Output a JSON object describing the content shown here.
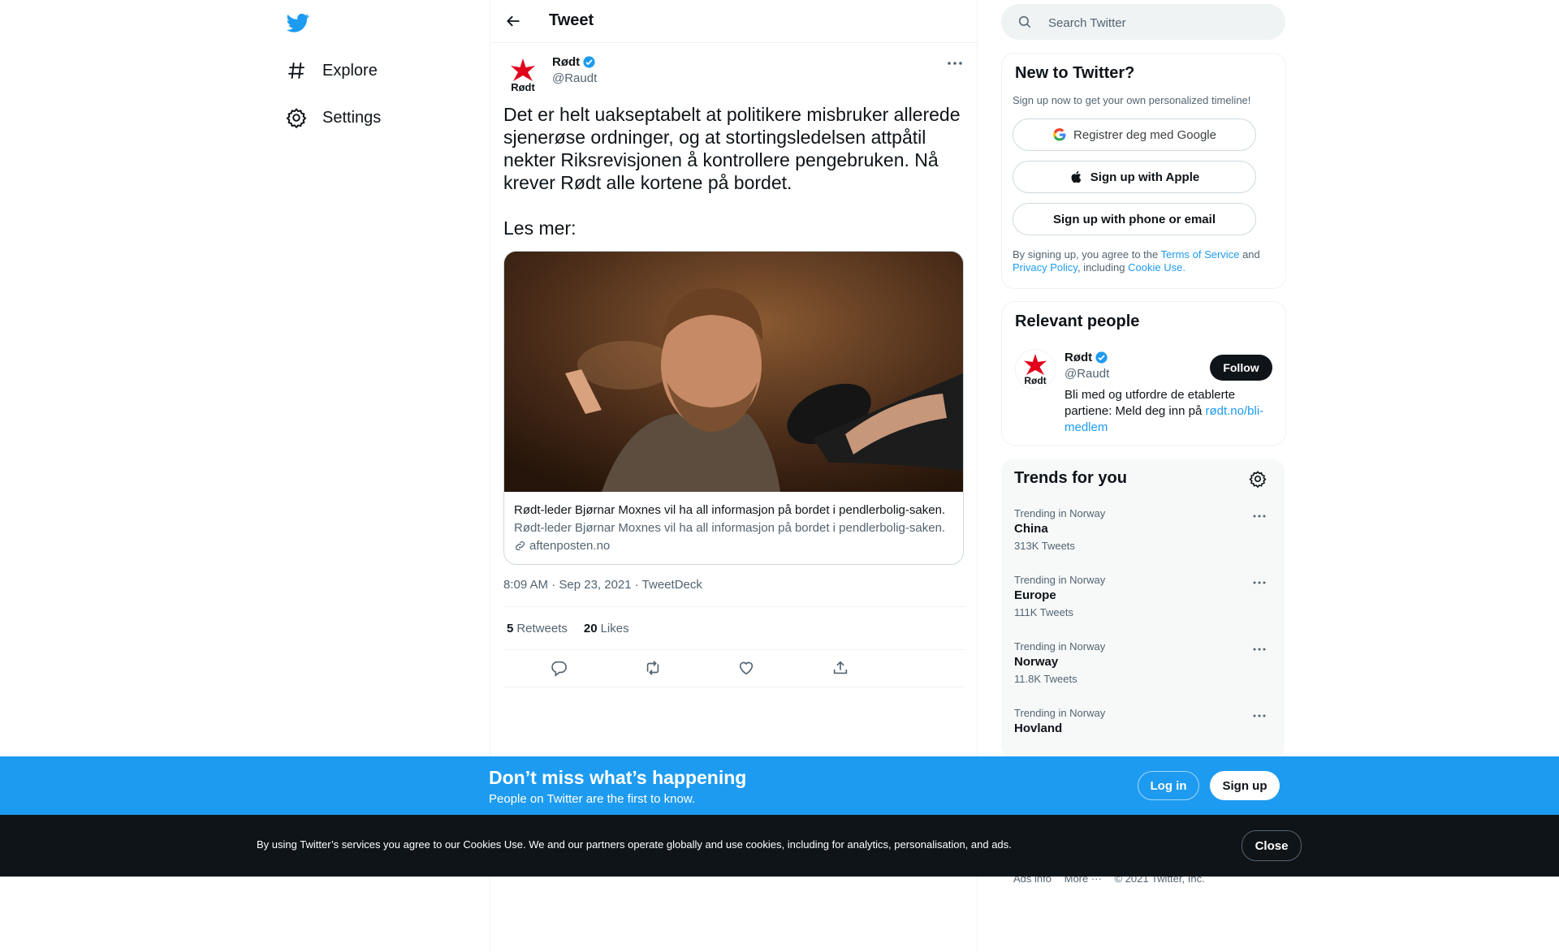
{
  "nav": {
    "items": [
      {
        "label": "Explore",
        "icon": "hashtag-icon"
      },
      {
        "label": "Settings",
        "icon": "gear-icon"
      }
    ]
  },
  "header": {
    "title": "Tweet"
  },
  "tweet": {
    "author_name": "Rødt",
    "author_handle": "@Raudt",
    "text": "Det er helt uakseptabelt at politikere misbruker allerede sjenerøse ordninger, og at stortingsledelsen attpåtil nekter Riksrevisjonen å kontrollere pengebruken. Nå krever Rødt alle kortene på bordet.\n\nLes mer:",
    "card": {
      "title": "Rødt-leder Bjørnar Moxnes vil ha all informasjon på bordet i pendlerbolig-saken.",
      "description": "Rødt-leder Bjørnar Moxnes vil ha all informasjon på bordet i pendlerbolig-saken.",
      "domain": "aftenposten.no"
    },
    "timestamp": "8:09 AM · Sep 23, 2021 · TweetDeck",
    "retweets_count": "5",
    "retweets_label": "Retweets",
    "likes_count": "20",
    "likes_label": "Likes",
    "logo_text": "Rødt"
  },
  "search": {
    "placeholder": "Search Twitter"
  },
  "new_to_twitter": {
    "title": "New to Twitter?",
    "subtitle": "Sign up now to get your own personalized timeline!",
    "google_button": "Registrer deg med Google",
    "apple_button": "Sign up with Apple",
    "phone_button": "Sign up with phone or email",
    "legal_prefix": "By signing up, you agree to the",
    "terms": "Terms of Service",
    "and": "and",
    "privacy": "Privacy Policy",
    "including": ", including",
    "cookie": "Cookie Use."
  },
  "relevant_people": {
    "title": "Relevant people",
    "name": "Rødt",
    "handle": "@Raudt",
    "bio": "Bli med og utfordre de etablerte partiene: Meld deg inn på",
    "bio_link": "rødt.no/bli-medlem",
    "follow": "Follow"
  },
  "trends": {
    "title": "Trends for you",
    "items": [
      {
        "context": "Trending in Norway",
        "name": "China",
        "count": "313K Tweets"
      },
      {
        "context": "Trending in Norway",
        "name": "Europe",
        "count": "111K Tweets"
      },
      {
        "context": "Trending in Norway",
        "name": "Norway",
        "count": "11.8K Tweets"
      },
      {
        "context": "Trending in Norway",
        "name": "Hovland",
        "count": ""
      }
    ]
  },
  "footer": {
    "ads_info": "Ads info",
    "more": "More ···",
    "copyright": "© 2021 Twitter, Inc."
  },
  "signup_bar": {
    "title": "Don’t miss what’s happening",
    "subtitle": "People on Twitter are the first to know.",
    "login": "Log in",
    "signup": "Sign up"
  },
  "cookie_bar": {
    "text": "By using Twitter’s services you agree to our Cookies Use. We and our partners operate globally and use cookies, including for analytics, personalisation, and ads.",
    "close": "Close"
  },
  "colors": {
    "accent": "#1d9bf0",
    "text": "#0f1419",
    "secondary": "#536471",
    "logo_red": "#e2001a"
  }
}
